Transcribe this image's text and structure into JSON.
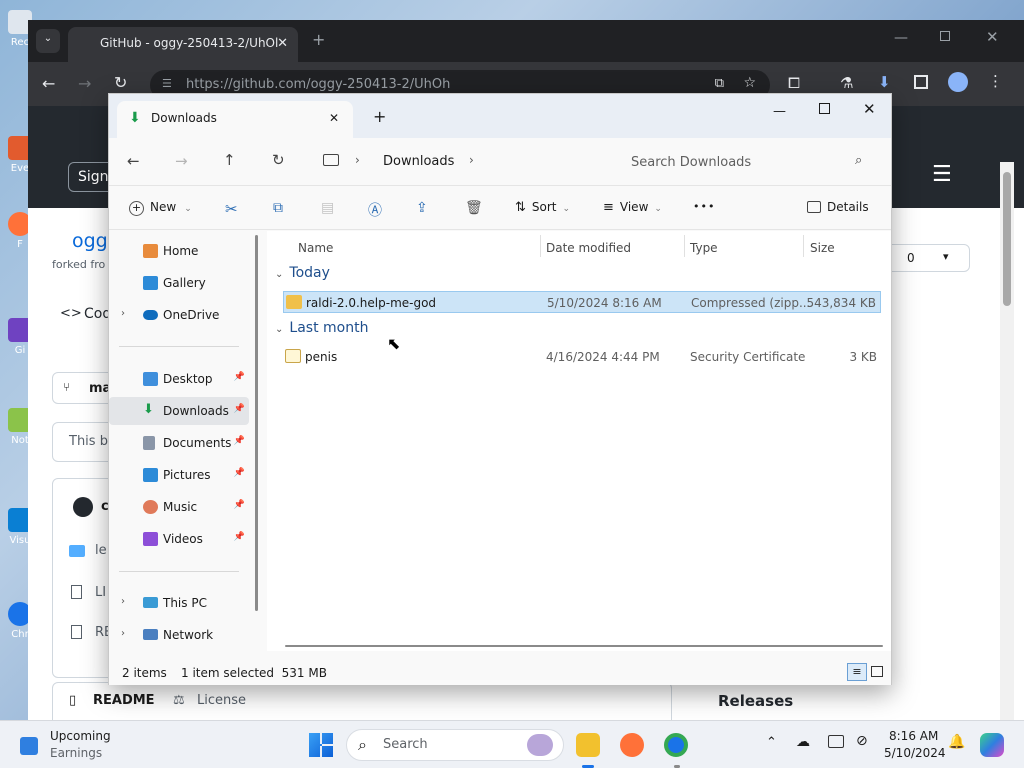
{
  "desktop": {
    "icons": [
      {
        "label": "Rec"
      },
      {
        "label": "Eve"
      },
      {
        "label": "F"
      },
      {
        "label": "Gi"
      },
      {
        "label": "Not"
      },
      {
        "label": "Visu"
      },
      {
        "label": "Chr"
      }
    ]
  },
  "browser": {
    "tab_title": "GitHub - oggy-250413-2/UhOl",
    "url": "https://github.com/oggy-250413-2/UhOh",
    "page": {
      "sign_in": "Sign",
      "repo_owner": "ogg",
      "forked_from": "forked fro",
      "code_tab": "Cod",
      "branch": "ma",
      "branch_note": "This b",
      "readme_tab": "README",
      "license_tab": "License",
      "releases": "Releases",
      "star_count": "0",
      "file_rows": [
        "le",
        "LI",
        "RE"
      ],
      "commit_char": "c"
    }
  },
  "explorer": {
    "tab_title": "Downloads",
    "breadcrumb": [
      "Downloads"
    ],
    "search_placeholder": "Search Downloads",
    "toolbar": {
      "new_label": "New",
      "sort_label": "Sort",
      "view_label": "View",
      "details_label": "Details",
      "more": "•••"
    },
    "nav": {
      "top": [
        {
          "label": "Home"
        },
        {
          "label": "Gallery"
        },
        {
          "label": "OneDrive"
        }
      ],
      "quick": [
        {
          "label": "Desktop"
        },
        {
          "label": "Downloads"
        },
        {
          "label": "Documents"
        },
        {
          "label": "Pictures"
        },
        {
          "label": "Music"
        },
        {
          "label": "Videos"
        }
      ],
      "bottom": [
        {
          "label": "This PC"
        },
        {
          "label": "Network"
        }
      ]
    },
    "columns": [
      "Name",
      "Date modified",
      "Type",
      "Size"
    ],
    "groups": [
      {
        "label": "Today",
        "files": [
          {
            "name": "raldi-2.0.help-me-god",
            "date": "5/10/2024 8:16 AM",
            "type": "Compressed (zipp...",
            "size": "543,834 KB"
          }
        ]
      },
      {
        "label": "Last month",
        "files": [
          {
            "name": "penis",
            "date": "4/16/2024 4:44 PM",
            "type": "Security Certificate",
            "size": "3 KB"
          }
        ]
      }
    ],
    "status": {
      "items": "2 items",
      "selected": "1 item selected  531 MB"
    }
  },
  "taskbar": {
    "weather_title": "Upcoming",
    "weather_sub": "Earnings",
    "search_label": "Search",
    "time": "8:16 AM",
    "date": "5/10/2024"
  }
}
